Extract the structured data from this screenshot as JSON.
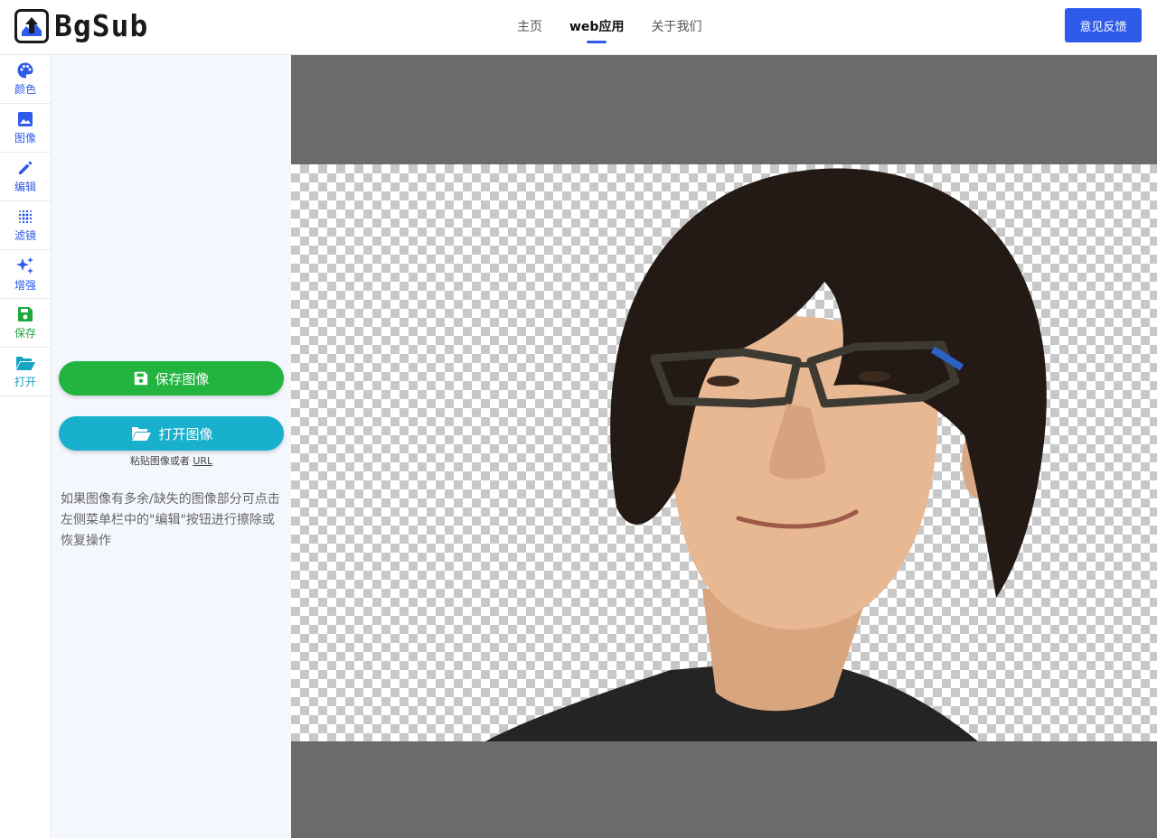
{
  "header": {
    "logo_text": "BgSub",
    "nav": [
      {
        "label": "主页",
        "active": false
      },
      {
        "label": "web应用",
        "active": true
      },
      {
        "label": "关于我们",
        "active": false
      }
    ],
    "feedback_label": "意见反馈",
    "accent_color": "#2f5bea"
  },
  "toolbar": {
    "items": [
      {
        "label": "颜色",
        "icon": "palette-icon"
      },
      {
        "label": "图像",
        "icon": "image-icon"
      },
      {
        "label": "编辑",
        "icon": "pencil-icon"
      },
      {
        "label": "滤镜",
        "icon": "dots-grid-icon"
      },
      {
        "label": "增强",
        "icon": "sparkle-icon"
      },
      {
        "label": "保存",
        "icon": "floppy-icon"
      },
      {
        "label": "打开",
        "icon": "folder-open-icon"
      }
    ]
  },
  "panel": {
    "save_button": "保存图像",
    "open_button": "打开图像",
    "paste_hint": "粘贴图像或者",
    "paste_url": "URL",
    "help_text": "如果图像有多余/缺失的图像部分可点击左侧菜单栏中的\"编辑\"按钮进行擦除或恢复操作",
    "save_color": "#22b43f",
    "open_color": "#18b0cc"
  },
  "canvas": {
    "background": "#6b6b6b",
    "image_content": "portrait with transparent checkerboard background"
  }
}
